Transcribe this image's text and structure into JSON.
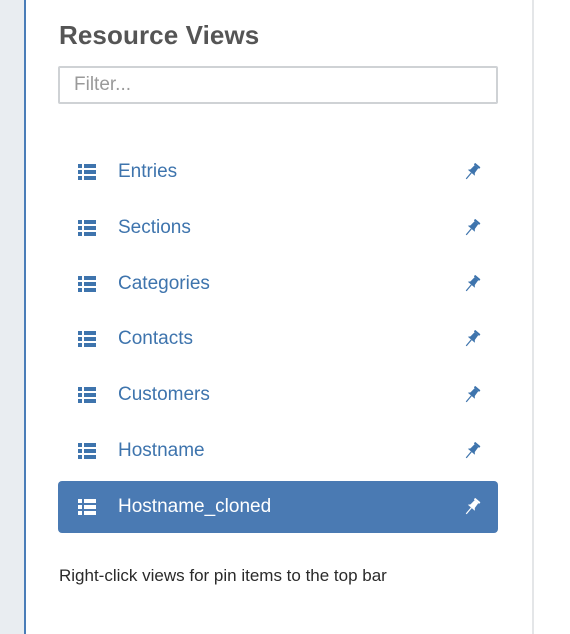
{
  "panel": {
    "title": "Resource Views",
    "filter_placeholder": "Filter...",
    "hint": "Right-click views for pin items to the top bar"
  },
  "views": [
    {
      "label": "Entries",
      "icon": "list-icon",
      "pin_icon": "pin-icon",
      "active": false
    },
    {
      "label": "Sections",
      "icon": "list-icon",
      "pin_icon": "pin-icon",
      "active": false
    },
    {
      "label": "Categories",
      "icon": "list-icon",
      "pin_icon": "pin-icon",
      "active": false
    },
    {
      "label": "Contacts",
      "icon": "list-icon",
      "pin_icon": "pin-icon",
      "active": false
    },
    {
      "label": "Customers",
      "icon": "list-icon",
      "pin_icon": "pin-icon",
      "active": false
    },
    {
      "label": "Hostname",
      "icon": "list-icon",
      "pin_icon": "pin-icon",
      "active": false
    },
    {
      "label": "Hostname_cloned",
      "icon": "list-icon",
      "pin_icon": "pin-icon",
      "active": true
    }
  ],
  "colors": {
    "accent": "#4a7ab3",
    "link": "#3e74ad",
    "title": "#555555",
    "gutter": "#e9edf1"
  }
}
